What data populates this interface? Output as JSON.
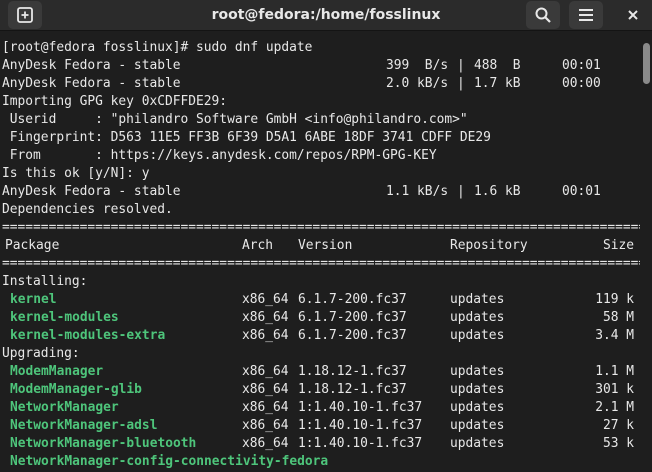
{
  "window": {
    "title": "root@fedora:/home/fosslinux"
  },
  "icons": {
    "new_tab": "plus-icon",
    "search": "search-icon",
    "menu": "hamburger-icon",
    "close": "close-icon"
  },
  "colors": {
    "package_name": "#4ec57b",
    "text": "#e8e8e8",
    "background": "#1e1e1e"
  },
  "terminal": {
    "prompt_line": "[root@fedora fosslinux]# sudo dnf update",
    "repo_lines": [
      {
        "name": "AnyDesk Fedora - stable",
        "speed": "399  B/s",
        "size": "488  B",
        "time": "00:01"
      },
      {
        "name": "AnyDesk Fedora - stable",
        "speed": "2.0 kB/s",
        "size": "1.7 kB",
        "time": "00:00"
      }
    ],
    "gpg_import": "Importing GPG key 0xCDFFDE29:",
    "userid": " Userid     : \"philandro Software GmbH <info@philandro.com>\"",
    "fingerprint": " Fingerprint: D563 11E5 FF3B 6F39 D5A1 6ABE 18DF 3741 CDFF DE29",
    "from": " From       : https://keys.anydesk.com/repos/RPM-GPG-KEY",
    "confirm": "Is this ok [y/N]: y",
    "repo_line3": {
      "name": "AnyDesk Fedora - stable",
      "speed": "1.1 kB/s",
      "size": "1.6 kB",
      "time": "00:01"
    },
    "deps": "Dependencies resolved.",
    "separator": "==========================================================================================",
    "headers": {
      "package": "Package",
      "arch": "Arch",
      "version": "Version",
      "repository": "Repository",
      "size": "Size"
    },
    "installing_label": "Installing:",
    "installing": [
      {
        "name": "kernel",
        "arch": "x86_64",
        "version": "6.1.7-200.fc37",
        "repo": "updates",
        "size": "119 k"
      },
      {
        "name": "kernel-modules",
        "arch": "x86_64",
        "version": "6.1.7-200.fc37",
        "repo": "updates",
        "size": "58 M"
      },
      {
        "name": "kernel-modules-extra",
        "arch": "x86_64",
        "version": "6.1.7-200.fc37",
        "repo": "updates",
        "size": "3.4 M"
      }
    ],
    "upgrading_label": "Upgrading:",
    "upgrading": [
      {
        "name": "ModemManager",
        "arch": "x86_64",
        "version": "1.18.12-1.fc37",
        "repo": "updates",
        "size": "1.1 M"
      },
      {
        "name": "ModemManager-glib",
        "arch": "x86_64",
        "version": "1.18.12-1.fc37",
        "repo": "updates",
        "size": "301 k"
      },
      {
        "name": "NetworkManager",
        "arch": "x86_64",
        "version": "1:1.40.10-1.fc37",
        "repo": "updates",
        "size": "2.1 M"
      },
      {
        "name": "NetworkManager-adsl",
        "arch": "x86_64",
        "version": "1:1.40.10-1.fc37",
        "repo": "updates",
        "size": "27 k"
      },
      {
        "name": "NetworkManager-bluetooth",
        "arch": "x86_64",
        "version": "1:1.40.10-1.fc37",
        "repo": "updates",
        "size": "53 k"
      }
    ],
    "last_package": "NetworkManager-config-connectivity-fedora"
  }
}
